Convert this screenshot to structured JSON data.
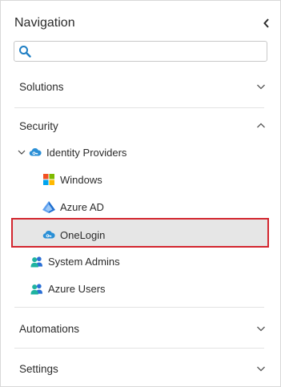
{
  "header": {
    "title": "Navigation"
  },
  "search": {
    "placeholder": "",
    "value": ""
  },
  "sections": {
    "solutions": {
      "label": "Solutions",
      "expanded": false
    },
    "security": {
      "label": "Security",
      "expanded": true
    },
    "automations": {
      "label": "Automations",
      "expanded": false
    },
    "settings": {
      "label": "Settings",
      "expanded": false
    }
  },
  "tree": {
    "identity_providers": {
      "label": "Identity Providers",
      "expanded": true
    },
    "windows": {
      "label": "Windows"
    },
    "azure_ad": {
      "label": "Azure AD"
    },
    "onelogin": {
      "label": "OneLogin",
      "selected": true
    },
    "system_admins": {
      "label": "System Admins"
    },
    "azure_users": {
      "label": "Azure Users"
    }
  },
  "colors": {
    "selection_border": "#d3262f",
    "selection_bg": "#e6e6e6",
    "search_icon": "#1f7fc4",
    "provider_icon": "#2a8fd6",
    "users_icon_primary": "#1fb3a0",
    "users_icon_secondary": "#2a6fd6"
  },
  "icons": {
    "collapse": "chevron-left-icon",
    "search": "search-icon",
    "expand": "chevron-down-icon",
    "collapse_section": "chevron-up-icon",
    "identity_provider": "cloud-key-icon",
    "windows": "windows-logo-icon",
    "azure_ad": "azure-ad-pyramid-icon",
    "users": "users-group-icon"
  }
}
